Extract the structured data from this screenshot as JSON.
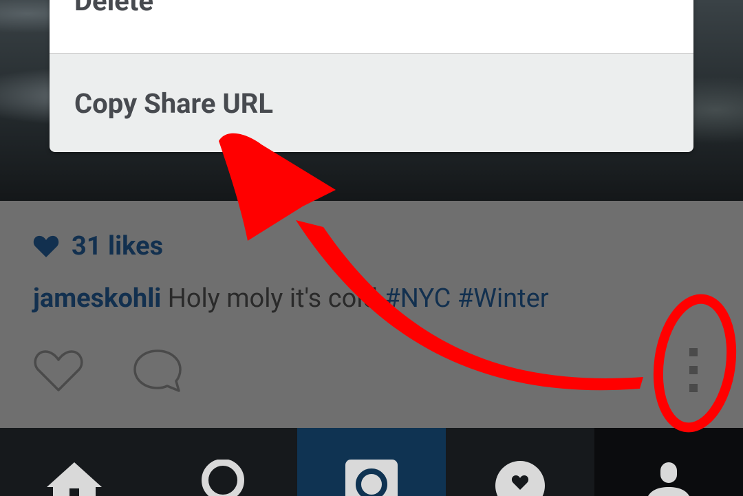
{
  "menu": {
    "items": [
      {
        "label": "Delete"
      },
      {
        "label": "Copy Share URL"
      }
    ]
  },
  "post": {
    "likes": "31 likes",
    "username": "jameskohli",
    "caption_text": "Holy moly it's cold",
    "hashtags": [
      "#NYC",
      "#Winter"
    ]
  },
  "icons": {
    "like": "heart-outline-icon",
    "comment": "comment-bubble-icon",
    "more": "vertical-dots-icon",
    "likes": "heart-filled-icon"
  },
  "nav": {
    "items": [
      {
        "icon": "home-icon"
      },
      {
        "icon": "search-icon"
      },
      {
        "icon": "camera-icon",
        "active": true
      },
      {
        "icon": "activity-heart-icon"
      },
      {
        "icon": "profile-icon"
      }
    ]
  },
  "colors": {
    "accent_blue": "#12304f",
    "nav_active": "#0f3352",
    "annotation_red": "#ff0000"
  }
}
